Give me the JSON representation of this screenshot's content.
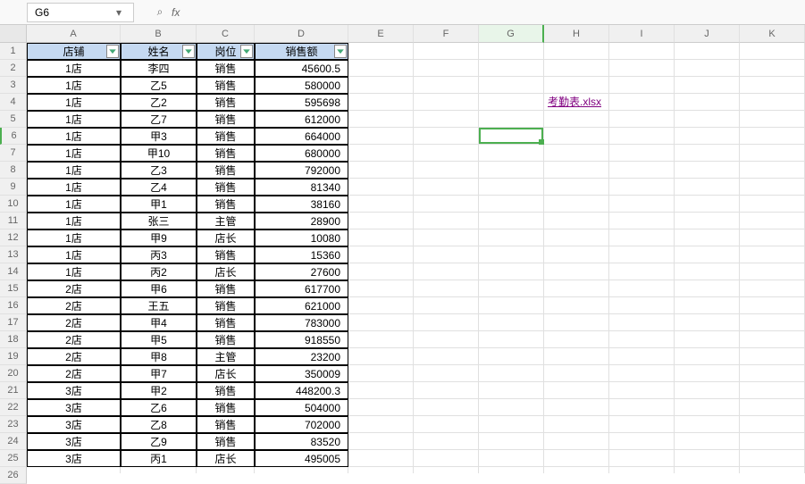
{
  "nameBox": {
    "value": "G6"
  },
  "formulaBar": {
    "fxLabel": "fx",
    "value": ""
  },
  "columns": [
    "A",
    "B",
    "C",
    "D",
    "E",
    "F",
    "G",
    "H",
    "I",
    "J",
    "K"
  ],
  "rowCount": 26,
  "activeCell": {
    "col": "G",
    "row": 6
  },
  "tableHeaders": [
    "店铺",
    "姓名",
    "岗位",
    "销售额"
  ],
  "tableData": [
    {
      "store": "1店",
      "name": "李四",
      "role": "销售",
      "amount": "45600.5"
    },
    {
      "store": "1店",
      "name": "乙5",
      "role": "销售",
      "amount": "580000"
    },
    {
      "store": "1店",
      "name": "乙2",
      "role": "销售",
      "amount": "595698"
    },
    {
      "store": "1店",
      "name": "乙7",
      "role": "销售",
      "amount": "612000"
    },
    {
      "store": "1店",
      "name": "甲3",
      "role": "销售",
      "amount": "664000"
    },
    {
      "store": "1店",
      "name": "甲10",
      "role": "销售",
      "amount": "680000"
    },
    {
      "store": "1店",
      "name": "乙3",
      "role": "销售",
      "amount": "792000"
    },
    {
      "store": "1店",
      "name": "乙4",
      "role": "销售",
      "amount": "81340"
    },
    {
      "store": "1店",
      "name": "甲1",
      "role": "销售",
      "amount": "38160"
    },
    {
      "store": "1店",
      "name": "张三",
      "role": "主管",
      "amount": "28900"
    },
    {
      "store": "1店",
      "name": "甲9",
      "role": "店长",
      "amount": "10080"
    },
    {
      "store": "1店",
      "name": "丙3",
      "role": "销售",
      "amount": "15360"
    },
    {
      "store": "1店",
      "name": "丙2",
      "role": "店长",
      "amount": "27600"
    },
    {
      "store": "2店",
      "name": "甲6",
      "role": "销售",
      "amount": "617700"
    },
    {
      "store": "2店",
      "name": "王五",
      "role": "销售",
      "amount": "621000"
    },
    {
      "store": "2店",
      "name": "甲4",
      "role": "销售",
      "amount": "783000"
    },
    {
      "store": "2店",
      "name": "甲5",
      "role": "销售",
      "amount": "918550"
    },
    {
      "store": "2店",
      "name": "甲8",
      "role": "主管",
      "amount": "23200"
    },
    {
      "store": "2店",
      "name": "甲7",
      "role": "店长",
      "amount": "350009"
    },
    {
      "store": "3店",
      "name": "甲2",
      "role": "销售",
      "amount": "448200.3"
    },
    {
      "store": "3店",
      "name": "乙6",
      "role": "销售",
      "amount": "504000"
    },
    {
      "store": "3店",
      "name": "乙8",
      "role": "销售",
      "amount": "702000"
    },
    {
      "store": "3店",
      "name": "乙9",
      "role": "销售",
      "amount": "83520"
    },
    {
      "store": "3店",
      "name": "丙1",
      "role": "店长",
      "amount": "495005"
    }
  ],
  "hyperlink": {
    "row": 4,
    "col": "H",
    "text": "考勤表.xlsx"
  },
  "icons": {
    "search": "⌕",
    "chevronDown": "▾"
  }
}
